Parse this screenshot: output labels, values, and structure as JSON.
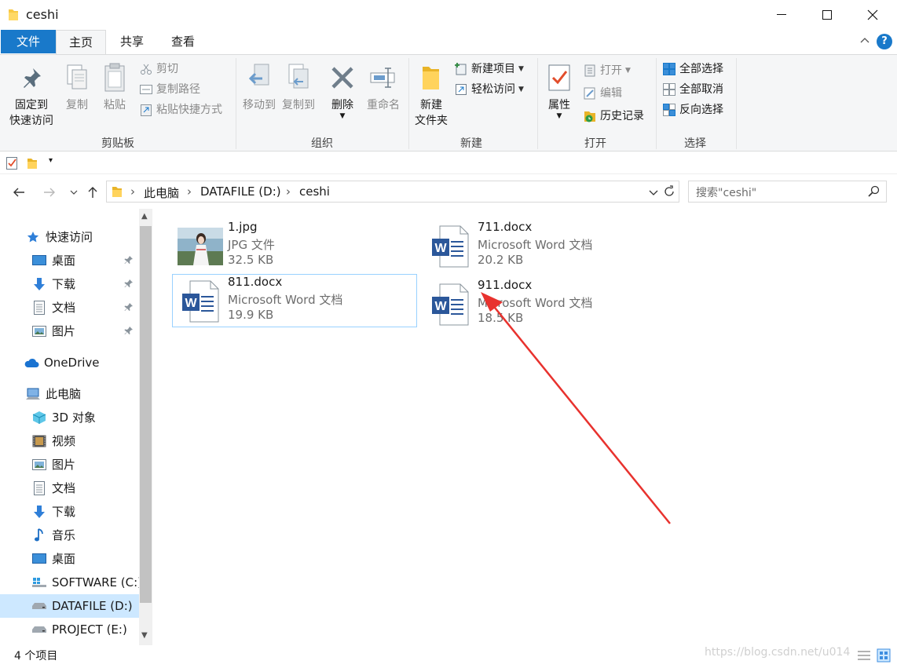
{
  "window": {
    "title": "ceshi"
  },
  "tabs": {
    "file": "文件",
    "home": "主页",
    "share": "共享",
    "view": "查看",
    "help": "?"
  },
  "ribbon": {
    "clipboard": {
      "label": "剪贴板",
      "pin": "固定到\n快速访问",
      "pin_line1": "固定到",
      "pin_line2": "快速访问",
      "copy": "复制",
      "paste": "粘贴",
      "cut": "剪切",
      "copy_path": "复制路径",
      "paste_shortcut": "粘贴快捷方式"
    },
    "organize": {
      "label": "组织",
      "move_to": "移动到",
      "copy_to": "复制到",
      "delete": "删除",
      "rename": "重命名"
    },
    "new": {
      "label": "新建",
      "new_folder_line1": "新建",
      "new_folder_line2": "文件夹",
      "new_item": "新建项目",
      "easy_access": "轻松访问"
    },
    "open": {
      "label": "打开",
      "properties": "属性",
      "open": "打开",
      "edit": "编辑",
      "history": "历史记录"
    },
    "select": {
      "label": "选择",
      "select_all": "全部选择",
      "select_none": "全部取消",
      "invert": "反向选择"
    }
  },
  "address": {
    "crumbs": [
      "此电脑",
      "DATAFILE (D:)",
      "ceshi"
    ],
    "search_placeholder": "搜索\"ceshi\""
  },
  "nav": {
    "quick_access": "快速访问",
    "qa_items": [
      "桌面",
      "下载",
      "文档",
      "图片"
    ],
    "onedrive": "OneDrive",
    "this_pc": "此电脑",
    "pc_items": [
      "3D 对象",
      "视频",
      "图片",
      "文档",
      "下载",
      "音乐",
      "桌面",
      "SOFTWARE (C:)",
      "DATAFILE (D:)",
      "PROJECT (E:)"
    ]
  },
  "files": [
    {
      "name": "1.jpg",
      "type": "JPG 文件",
      "size": "32.5 KB"
    },
    {
      "name": "711.docx",
      "type": "Microsoft Word 文档",
      "size": "20.2 KB"
    },
    {
      "name": "811.docx",
      "type": "Microsoft Word 文档",
      "size": "19.9 KB"
    },
    {
      "name": "911.docx",
      "type": "Microsoft Word 文档",
      "size": "18.5 KB"
    }
  ],
  "status": {
    "count": "4 个项目"
  },
  "watermark": "https://blog.csdn.net/u014",
  "colors": {
    "accent": "#1979ca",
    "selection": "#cde8ff",
    "annotation_arrow": "#e8322e"
  }
}
